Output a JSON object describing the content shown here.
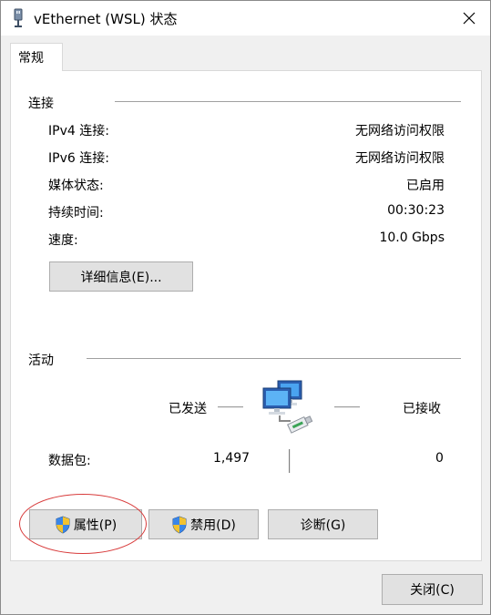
{
  "window": {
    "title": "vEthernet (WSL) 状态",
    "close_label": "关闭(C)"
  },
  "tabs": [
    {
      "label": "常规"
    }
  ],
  "connection": {
    "label": "连接",
    "rows": [
      {
        "label": "IPv4 连接:",
        "value": "无网络访问权限"
      },
      {
        "label": "IPv6 连接:",
        "value": "无网络访问权限"
      },
      {
        "label": "媒体状态:",
        "value": "已启用"
      },
      {
        "label": "持续时间:",
        "value": "00:30:23"
      },
      {
        "label": "速度:",
        "value": "10.0 Gbps"
      }
    ],
    "details_button": "详细信息(E)..."
  },
  "activity": {
    "label": "活动",
    "sent_label": "已发送",
    "received_label": "已接收",
    "packets_label": "数据包:",
    "packets_sent": "1,497",
    "packets_received": "0"
  },
  "buttons": {
    "properties": "属性(P)",
    "disable": "禁用(D)",
    "diagnose": "诊断(G)"
  },
  "icons": {
    "title": "network-adapter-icon",
    "activity": "network-computers-icon",
    "shield": "uac-shield-icon"
  },
  "colors": {
    "annotation": "#d83b3b",
    "button_bg": "#e1e1e1",
    "panel_bg": "#ffffff",
    "window_bg": "#f0f0f0"
  }
}
